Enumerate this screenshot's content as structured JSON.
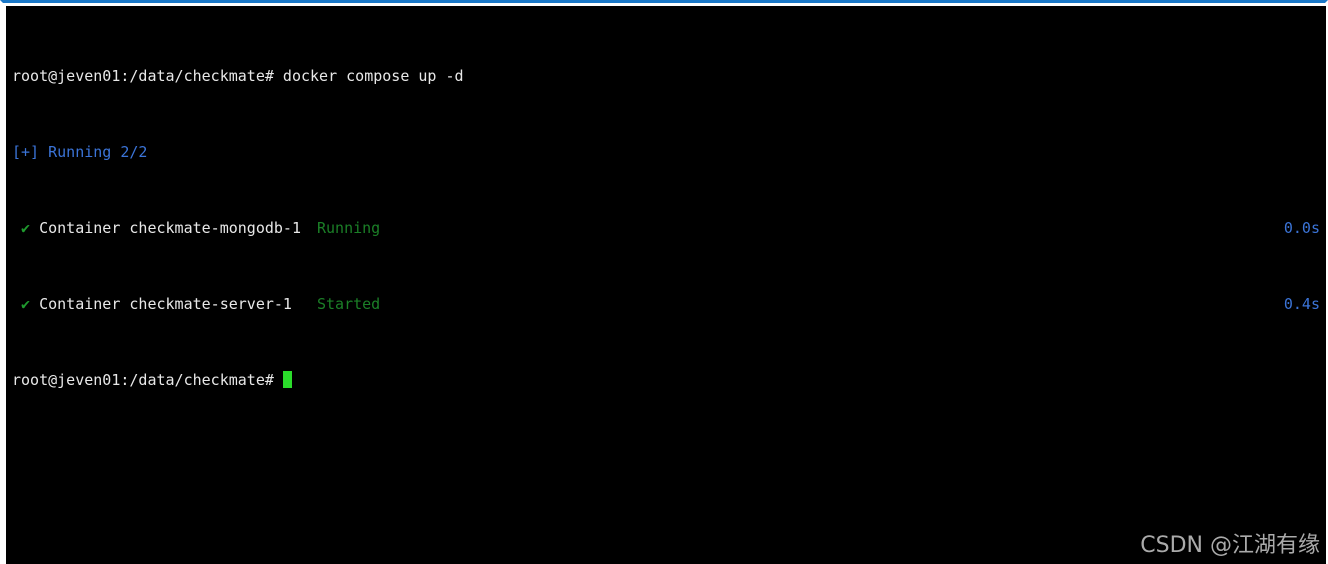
{
  "terminal": {
    "lines": [
      {
        "prompt": "root@jeven01:/data/checkmate#",
        "command": " docker compose up -d"
      },
      {
        "text": "[+] Running 2/2"
      },
      {
        "check": "✔",
        "label": "Container checkmate-mongodb-1",
        "status": "Running",
        "time": "0.0s"
      },
      {
        "check": "✔",
        "label": "Container checkmate-server-1",
        "status": "Started",
        "time": "0.4s"
      },
      {
        "prompt": "root@jeven01:/data/checkmate#",
        "command": " "
      }
    ]
  },
  "watermark": "CSDN @江湖有缘",
  "colors": {
    "background": "#000000",
    "text": "#e8e8e8",
    "blue": "#3b74d8",
    "green": "#1f9a2e",
    "cursor": "#2bdc2b",
    "window_border": "#1a78c8"
  }
}
